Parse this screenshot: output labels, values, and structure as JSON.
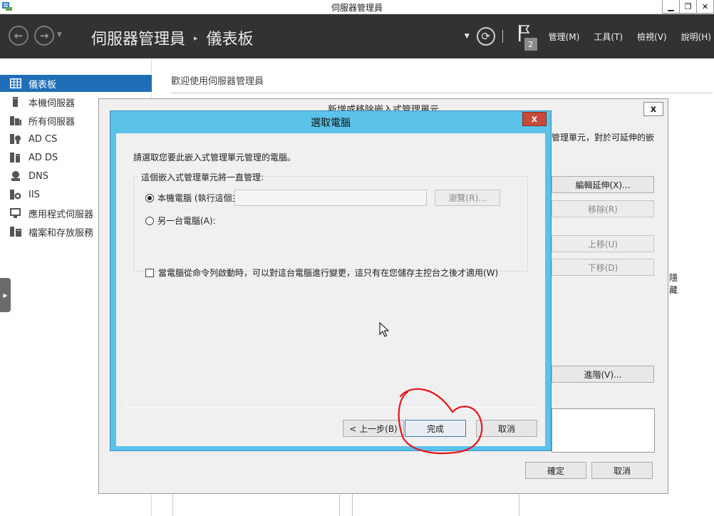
{
  "window": {
    "title": "伺服器管理員",
    "controls": {
      "minimize": "▁",
      "restore": "❐",
      "close": "✕"
    }
  },
  "header": {
    "breadcrumb_root": "伺服器管理員",
    "breadcrumb_separator": "▸",
    "breadcrumb_current": "儀表板",
    "notification_count": "2",
    "menus": [
      "管理(M)",
      "工具(T)",
      "檢視(V)",
      "說明(H)"
    ]
  },
  "sidebar": {
    "items": [
      {
        "label": "儀表板",
        "icon": "dashboard-icon",
        "active": true
      },
      {
        "label": "本機伺服器",
        "icon": "local-server-icon"
      },
      {
        "label": "所有伺服器",
        "icon": "all-servers-icon"
      },
      {
        "label": "AD CS",
        "icon": "ad-cs-icon"
      },
      {
        "label": "AD DS",
        "icon": "ad-ds-icon"
      },
      {
        "label": "DNS",
        "icon": "dns-icon"
      },
      {
        "label": "IIS",
        "icon": "iis-icon"
      },
      {
        "label": "應用程式伺服器",
        "icon": "app-server-icon"
      },
      {
        "label": "檔案和存放服務",
        "icon": "file-storage-icon"
      }
    ],
    "collapse_glyph": "▶"
  },
  "main": {
    "welcome": "歡迎使用伺服器管理員"
  },
  "outer_dialog": {
    "title": "新增或移除嵌入式管理單元",
    "desc_fragment": "管理單元，對於可延伸的嵌",
    "edit_extensions_button": "編輯延伸(X)...",
    "remove_button": "移除(R)",
    "move_up_button": "上移(U)",
    "move_down_button": "下移(D)",
    "hide_fragment": "隱藏",
    "advanced_button": "進階(V)...",
    "ok_button": "確定",
    "cancel_button": "取消",
    "close_glyph": "x"
  },
  "dialog": {
    "title": "選取電腦",
    "close_glyph": "x",
    "prompt": "請選取您要此嵌入式管理單元管理的電腦。",
    "group_label": "這個嵌入式管理單元將一直管理:",
    "local_option": "本機電腦 (執行這個主控台的電腦)(L):",
    "local_selected": true,
    "other_option": "另一台電腦(A):",
    "other_value": "",
    "browse_button": "瀏覽(R)...",
    "cmdline_option": "當電腦從命令列啟動時，可以對這台電腦進行變更，這只有在您儲存主控台之後才適用(W)",
    "cmdline_checked": false,
    "back_button": "< 上一步(B)",
    "finish_button": "完成",
    "cancel_button": "取消"
  },
  "colors": {
    "header_bg": "#323232",
    "sidebar_active": "#1e6fb8",
    "dialog_frame": "#5bc2ea",
    "close_button": "#c74a3a",
    "annotation": "#e8161b"
  }
}
